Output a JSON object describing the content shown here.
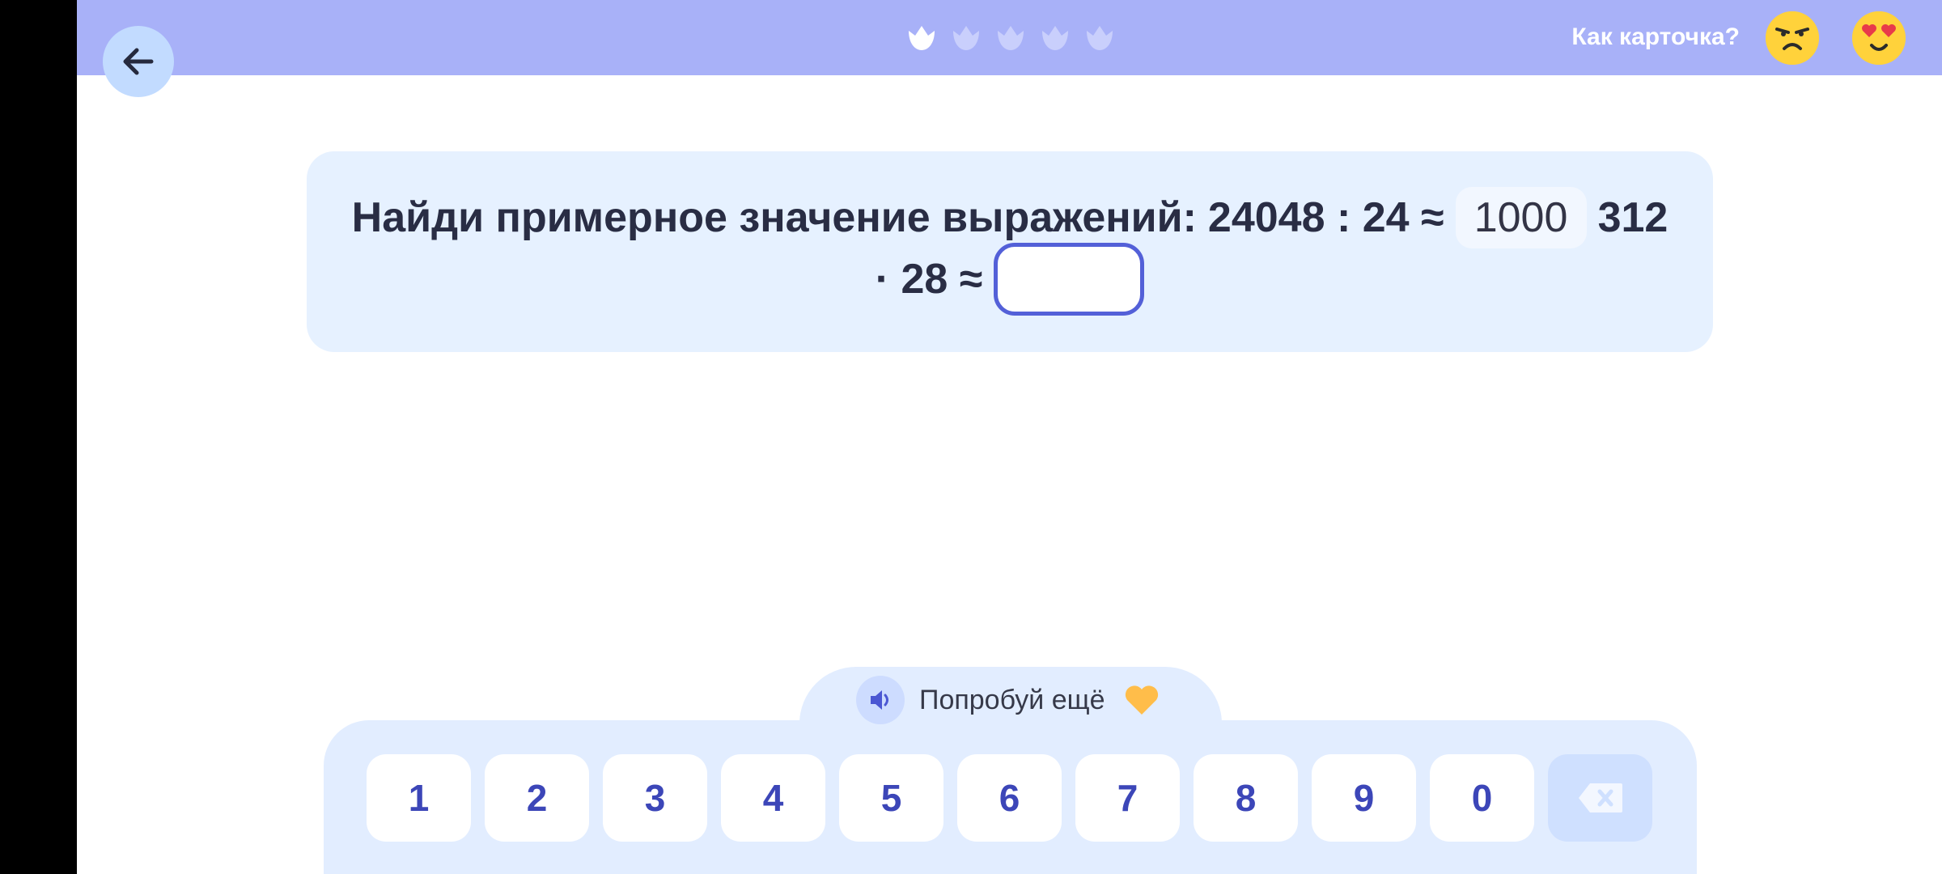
{
  "header": {
    "back_icon": "arrow-left-icon",
    "progress": {
      "total": 5,
      "current": 1
    },
    "feedback_label": "Как карточка?",
    "reactions": [
      {
        "name": "angry-emoji",
        "icon": "angry-face-icon"
      },
      {
        "name": "love-emoji",
        "icon": "heart-eyes-face-icon"
      }
    ]
  },
  "task": {
    "prompt": "Найди примерное значение выражений:",
    "expr1_left": "24048 : 24 ≈",
    "expr1_answer": "1000",
    "expr2_part1": "312",
    "expr2_part2": "· 28 ≈",
    "expr2_answer": ""
  },
  "hint": {
    "sound_icon": "speaker-icon",
    "text": "Попробуй ещё",
    "heart_icon": "heart-icon"
  },
  "keyboard": {
    "keys": [
      "1",
      "2",
      "3",
      "4",
      "5",
      "6",
      "7",
      "8",
      "9",
      "0"
    ],
    "backspace_icon": "backspace-icon"
  },
  "colors": {
    "topbar": "#a8b1f8",
    "card": "#e6f1ff",
    "keyboard": "#e2edff",
    "accent": "#5360d8",
    "key_text": "#3c46b8",
    "emoji": "#ffd23b",
    "heart": "#ffbd4a"
  }
}
